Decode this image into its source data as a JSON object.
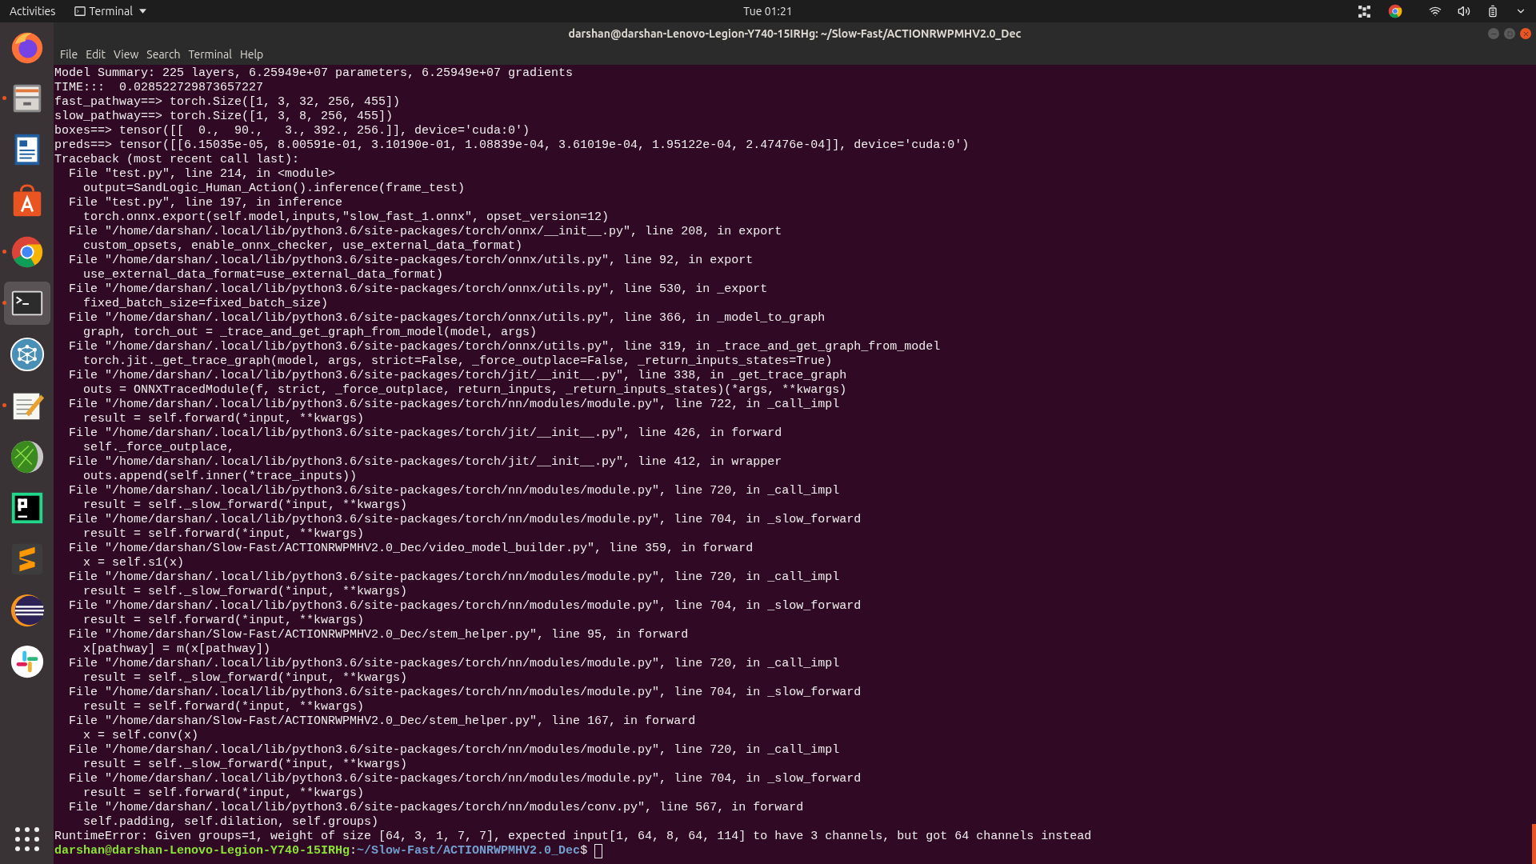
{
  "top_bar": {
    "activities": "Activities",
    "app_menu": "Terminal",
    "clock": "Tue 01:21"
  },
  "dock": [
    {
      "kind": "firefox",
      "running": false,
      "selected": false
    },
    {
      "kind": "files",
      "running": true,
      "selected": false
    },
    {
      "kind": "writer",
      "running": false,
      "selected": false
    },
    {
      "kind": "store",
      "running": false,
      "selected": false
    },
    {
      "kind": "chrome",
      "running": true,
      "selected": false
    },
    {
      "kind": "terminal",
      "running": true,
      "selected": true
    },
    {
      "kind": "network",
      "running": false,
      "selected": false
    },
    {
      "kind": "notepad",
      "running": true,
      "selected": false
    },
    {
      "kind": "sphere",
      "running": false,
      "selected": false
    },
    {
      "kind": "pycharm",
      "running": false,
      "selected": false
    },
    {
      "kind": "sublime",
      "running": false,
      "selected": false
    },
    {
      "kind": "eclipse",
      "running": false,
      "selected": false
    },
    {
      "kind": "slack",
      "running": false,
      "selected": false
    }
  ],
  "window": {
    "title": "darshan@darshan-Lenovo-Legion-Y740-15IRHg: ~/Slow-Fast/ACTIONRWPMHV2.0_Dec"
  },
  "menu": [
    "File",
    "Edit",
    "View",
    "Search",
    "Terminal",
    "Help"
  ],
  "output": [
    "Model Summary: 225 layers, 6.25949e+07 parameters, 6.25949e+07 gradients",
    "TIME:::  0.028522729873657227",
    "fast_pathway==> torch.Size([1, 3, 32, 256, 455])",
    "slow_pathway==> torch.Size([1, 3, 8, 256, 455])",
    "boxes==> tensor([[  0.,  90.,   3., 392., 256.]], device='cuda:0')",
    "preds==> tensor([[6.15035e-05, 8.00591e-01, 3.10190e-01, 1.08839e-04, 3.61019e-04, 1.95122e-04, 2.47476e-04]], device='cuda:0')",
    "Traceback (most recent call last):",
    "  File \"test.py\", line 214, in <module>",
    "    output=SandLogic_Human_Action().inference(frame_test)",
    "  File \"test.py\", line 197, in inference",
    "    torch.onnx.export(self.model,inputs,\"slow_fast_1.onnx\", opset_version=12)",
    "  File \"/home/darshan/.local/lib/python3.6/site-packages/torch/onnx/__init__.py\", line 208, in export",
    "    custom_opsets, enable_onnx_checker, use_external_data_format)",
    "  File \"/home/darshan/.local/lib/python3.6/site-packages/torch/onnx/utils.py\", line 92, in export",
    "    use_external_data_format=use_external_data_format)",
    "  File \"/home/darshan/.local/lib/python3.6/site-packages/torch/onnx/utils.py\", line 530, in _export",
    "    fixed_batch_size=fixed_batch_size)",
    "  File \"/home/darshan/.local/lib/python3.6/site-packages/torch/onnx/utils.py\", line 366, in _model_to_graph",
    "    graph, torch_out = _trace_and_get_graph_from_model(model, args)",
    "  File \"/home/darshan/.local/lib/python3.6/site-packages/torch/onnx/utils.py\", line 319, in _trace_and_get_graph_from_model",
    "    torch.jit._get_trace_graph(model, args, strict=False, _force_outplace=False, _return_inputs_states=True)",
    "  File \"/home/darshan/.local/lib/python3.6/site-packages/torch/jit/__init__.py\", line 338, in _get_trace_graph",
    "    outs = ONNXTracedModule(f, strict, _force_outplace, return_inputs, _return_inputs_states)(*args, **kwargs)",
    "  File \"/home/darshan/.local/lib/python3.6/site-packages/torch/nn/modules/module.py\", line 722, in _call_impl",
    "    result = self.forward(*input, **kwargs)",
    "  File \"/home/darshan/.local/lib/python3.6/site-packages/torch/jit/__init__.py\", line 426, in forward",
    "    self._force_outplace,",
    "  File \"/home/darshan/.local/lib/python3.6/site-packages/torch/jit/__init__.py\", line 412, in wrapper",
    "    outs.append(self.inner(*trace_inputs))",
    "  File \"/home/darshan/.local/lib/python3.6/site-packages/torch/nn/modules/module.py\", line 720, in _call_impl",
    "    result = self._slow_forward(*input, **kwargs)",
    "  File \"/home/darshan/.local/lib/python3.6/site-packages/torch/nn/modules/module.py\", line 704, in _slow_forward",
    "    result = self.forward(*input, **kwargs)",
    "  File \"/home/darshan/Slow-Fast/ACTIONRWPMHV2.0_Dec/video_model_builder.py\", line 359, in forward",
    "    x = self.s1(x)",
    "  File \"/home/darshan/.local/lib/python3.6/site-packages/torch/nn/modules/module.py\", line 720, in _call_impl",
    "    result = self._slow_forward(*input, **kwargs)",
    "  File \"/home/darshan/.local/lib/python3.6/site-packages/torch/nn/modules/module.py\", line 704, in _slow_forward",
    "    result = self.forward(*input, **kwargs)",
    "  File \"/home/darshan/Slow-Fast/ACTIONRWPMHV2.0_Dec/stem_helper.py\", line 95, in forward",
    "    x[pathway] = m(x[pathway])",
    "  File \"/home/darshan/.local/lib/python3.6/site-packages/torch/nn/modules/module.py\", line 720, in _call_impl",
    "    result = self._slow_forward(*input, **kwargs)",
    "  File \"/home/darshan/.local/lib/python3.6/site-packages/torch/nn/modules/module.py\", line 704, in _slow_forward",
    "    result = self.forward(*input, **kwargs)",
    "  File \"/home/darshan/Slow-Fast/ACTIONRWPMHV2.0_Dec/stem_helper.py\", line 167, in forward",
    "    x = self.conv(x)",
    "  File \"/home/darshan/.local/lib/python3.6/site-packages/torch/nn/modules/module.py\", line 720, in _call_impl",
    "    result = self._slow_forward(*input, **kwargs)",
    "  File \"/home/darshan/.local/lib/python3.6/site-packages/torch/nn/modules/module.py\", line 704, in _slow_forward",
    "    result = self.forward(*input, **kwargs)",
    "  File \"/home/darshan/.local/lib/python3.6/site-packages/torch/nn/modules/conv.py\", line 567, in forward",
    "    self.padding, self.dilation, self.groups)",
    "RuntimeError: Given groups=1, weight of size [64, 3, 1, 7, 7], expected input[1, 64, 8, 64, 114] to have 3 channels, but got 64 channels instead"
  ],
  "prompt": {
    "user": "darshan@darshan-Lenovo-Legion-Y740-15IRHg",
    "separator": ":",
    "path": "~/Slow-Fast/ACTIONRWPMHV2.0_Dec",
    "symbol": "$"
  }
}
